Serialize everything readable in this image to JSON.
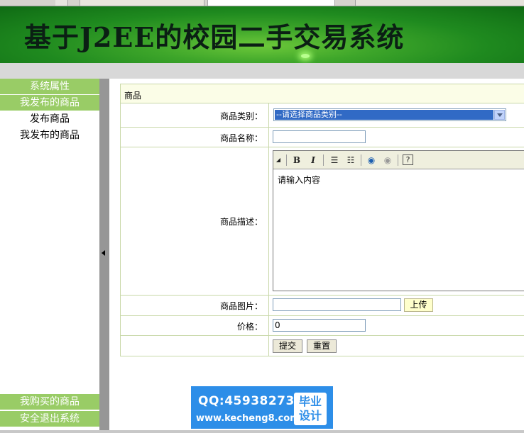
{
  "banner": {
    "title": "基于J2EE的校园二手交易系统"
  },
  "menu": {
    "sections": [
      {
        "label": "系统属性"
      },
      {
        "label": "我发布的商品"
      }
    ],
    "items": [
      {
        "label": "发布商品"
      },
      {
        "label": "我发布的商品"
      }
    ],
    "bottom": [
      {
        "label": "我购买的商品"
      },
      {
        "label": "安全退出系统"
      }
    ]
  },
  "form": {
    "header": "商品",
    "category_label": "商品类别：",
    "category_selected": "--请选择商品类别--",
    "name_label": "商品名称：",
    "name_value": "",
    "desc_label": "商品描述：",
    "desc_value": "请输入内容",
    "image_label": "商品图片：",
    "image_value": "",
    "upload_label": "上传",
    "price_label": "价格：",
    "price_value": "0",
    "submit_label": "提交",
    "reset_label": "重置"
  },
  "editor_toolbar": [
    "bold-icon",
    "italic-icon",
    "ordered-list-icon",
    "unordered-list-icon",
    "link-icon",
    "unlink-icon",
    "help-icon"
  ],
  "ad": {
    "qq": "QQ:459382737",
    "url": "www.kecheng8.com",
    "badge_line1": "毕业",
    "badge_line2": "设计"
  },
  "colors": {
    "banner_green": "#1f8a1f",
    "menu_green": "#99cc66",
    "ad_blue": "#2d8ee8",
    "select_blue": "#316ac5"
  }
}
